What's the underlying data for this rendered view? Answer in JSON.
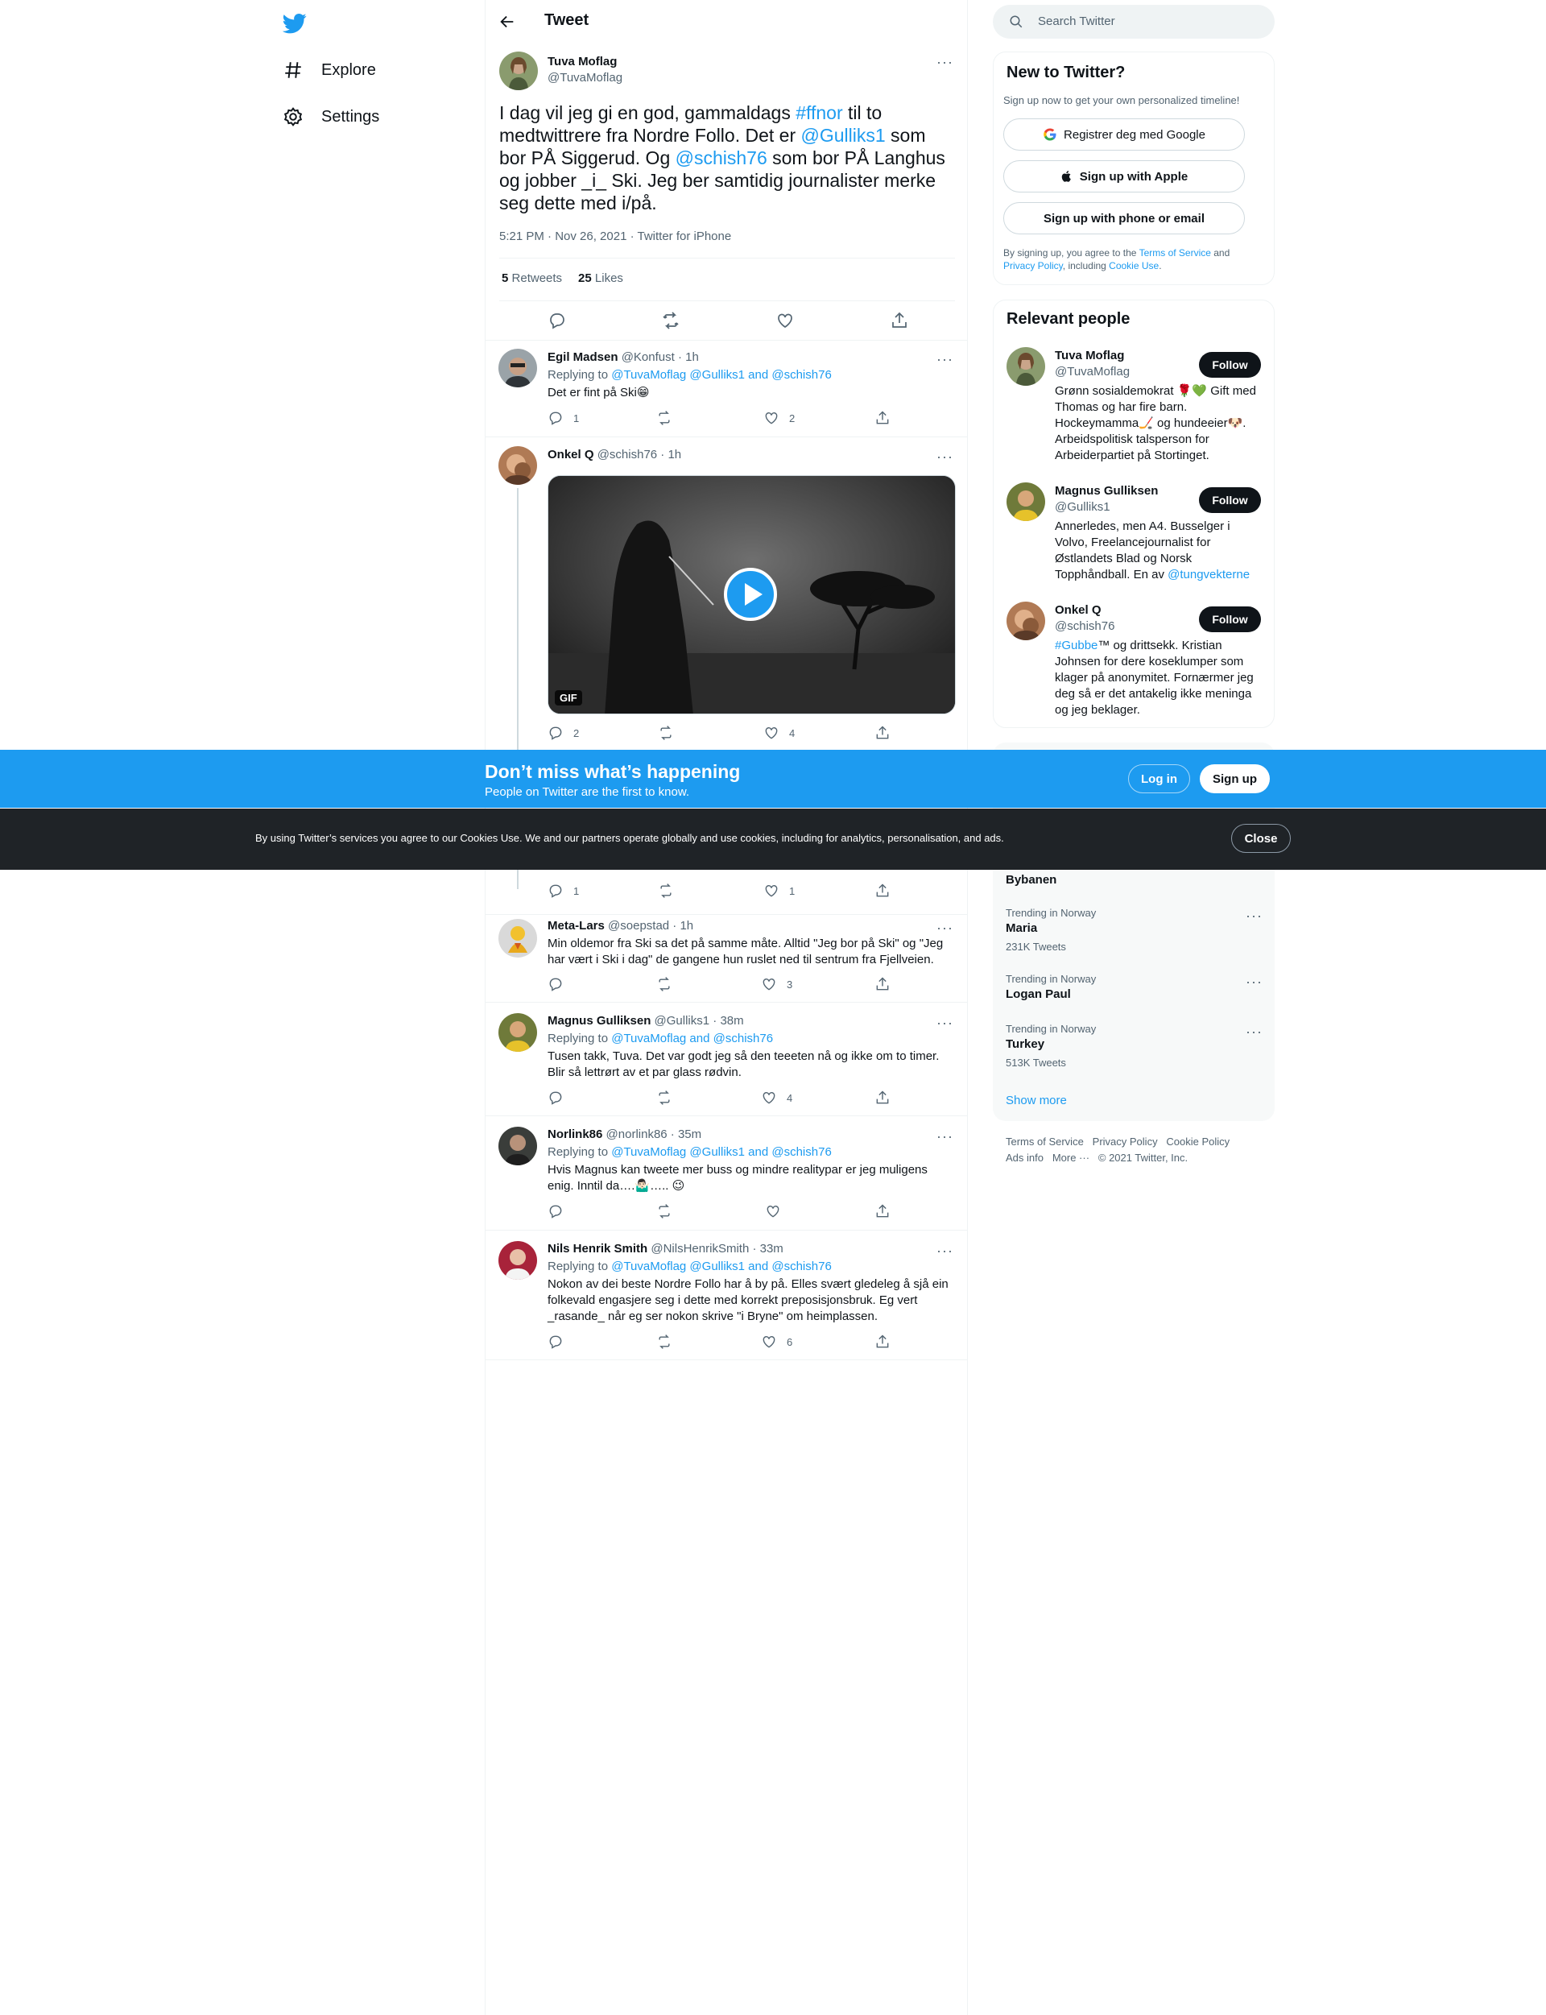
{
  "nav": {
    "items": [
      {
        "label": "Explore",
        "icon": "hashtag-icon"
      },
      {
        "label": "Settings",
        "icon": "gear-icon"
      }
    ]
  },
  "header": {
    "title": "Tweet"
  },
  "focal": {
    "name": "Tuva Moflag",
    "handle": "@TuvaMoflag",
    "text_parts": [
      {
        "t": "I dag vil jeg gi en god, gammaldags ",
        "link": false
      },
      {
        "t": "#ffnor",
        "link": true
      },
      {
        "t": " til to medtwittrere fra Nordre Follo. Det er ",
        "link": false
      },
      {
        "t": "@Gulliks1",
        "link": true
      },
      {
        "t": " som bor PÅ Siggerud. Og ",
        "link": false
      },
      {
        "t": "@schish76",
        "link": true
      },
      {
        "t": " som bor PÅ Langhus og jobber _i_ Ski. Jeg ber samtidig journalister merke seg dette med i/på.",
        "link": false
      }
    ],
    "meta": "5:21 PM · Nov 26, 2021 · Twitter for iPhone",
    "retweets": "5",
    "retweets_label": "Retweets",
    "likes": "25",
    "likes_label": "Likes"
  },
  "replies": [
    {
      "name": "Egil Madsen",
      "handle_time": "@Konfust · 1h",
      "replying_to": "@TuvaMoflag @Gulliks1 and @schish76",
      "text": "Det er fint på Ski😁",
      "replies": "1",
      "likes": "2"
    },
    {
      "name": "Onkel Q",
      "handle_time": "@schish76 · 1h",
      "gif_label": "GIF",
      "replies": "2",
      "likes": "4"
    },
    {
      "replies": "1",
      "likes": "1"
    },
    {
      "name": "Meta-Lars",
      "handle_time": "@soepstad · 1h",
      "text": "Min oldemor fra Ski sa det på samme måte. Alltid \"Jeg bor på Ski\" og \"Jeg har vært i Ski i dag\" de gangene hun ruslet ned til sentrum fra Fjellveien.",
      "replies": "",
      "likes": "3"
    },
    {
      "name": "Magnus Gulliksen",
      "handle_time": "@Gulliks1 · 38m",
      "replying_to": "@TuvaMoflag and @schish76",
      "text": "Tusen takk, Tuva. Det var godt jeg så den teeeten nå og ikke om to timer. Blir så lettrørt av et par glass rødvin.",
      "replies": "",
      "likes": "4"
    },
    {
      "name": "Norlink86",
      "handle_time": "@norlink86 · 35m",
      "replying_to": "@TuvaMoflag @Gulliks1 and @schish76",
      "text": "Hvis Magnus kan tweete mer buss og mindre realitypar er jeg muligens enig. Inntil da….🤷🏻‍♂️….. 😉",
      "replies": "",
      "likes": ""
    },
    {
      "name": "Nils Henrik Smith",
      "handle_time": "@NilsHenrikSmith · 33m",
      "replying_to": "@TuvaMoflag @Gulliks1 and @schish76",
      "text": "Nokon av dei beste Nordre Follo har å by på. Elles svært gledeleg å sjå ein folkevald engasjere seg i dette med korrekt preposisjonsbruk. Eg vert _rasande_ når eg ser nokon skrive \"i Bryne\" om heimplassen.",
      "replies": "",
      "likes": "6"
    }
  ],
  "sidebar": {
    "search_placeholder": "Search Twitter",
    "new_title": "New to Twitter?",
    "new_sub": "Sign up now to get your own personalized timeline!",
    "btn_google": "Registrer deg med Google",
    "btn_apple": "Sign up with Apple",
    "btn_phone": "Sign up with phone or email",
    "terms_1": "By signing up, you agree to the ",
    "terms_tos": "Terms of Service",
    "terms_2": " and ",
    "terms_pp": "Privacy Policy",
    "terms_3": ", including ",
    "terms_cookie": "Cookie Use",
    "terms_4": ".",
    "people_title": "Relevant people",
    "people": [
      {
        "name": "Tuva Moflag",
        "handle": "@TuvaMoflag",
        "bio": "Grønn sosialdemokrat 🌹💚 Gift med Thomas og har fire barn. Hockeymamma🏒 og hundeeier🐶. Arbeidspolitisk talsperson for Arbeiderpartiet på Stortinget.",
        "follow": "Follow"
      },
      {
        "name": "Magnus Gulliksen",
        "handle": "@Gulliks1",
        "bio": "Annerledes, men A4. Busselger i Volvo, Freelancejournalist for Østlandets Blad og Norsk Topphåndball. En av ",
        "bio_link": "@tungvekterne",
        "follow": "Follow"
      },
      {
        "name": "Onkel Q",
        "handle": "@schish76",
        "bio_link": "#Gubbe",
        "bio": "™ og drittsekk. Kristian Johnsen for dere koseklumper som klager på anonymitet. Fornærmer jeg deg så er det antakelig ikke meninga og jeg beklager.",
        "follow": "Follow"
      }
    ],
    "trends": [
      {
        "context": "",
        "name": "Bybanen",
        "count": ""
      },
      {
        "context": "Trending in Norway",
        "name": "Maria",
        "count": "231K Tweets"
      },
      {
        "context": "Trending in Norway",
        "name": "Logan Paul",
        "count": ""
      },
      {
        "context": "Trending in Norway",
        "name": "Turkey",
        "count": "513K Tweets"
      }
    ],
    "show_more": "Show more",
    "footer": {
      "tos": "Terms of Service",
      "privacy": "Privacy Policy",
      "cookie": "Cookie Policy",
      "ads": "Ads info",
      "more": "More ···",
      "copyright": "© 2021 Twitter, Inc."
    }
  },
  "banner": {
    "title": "Don’t miss what’s happening",
    "subtitle": "People on Twitter are the first to know.",
    "login": "Log in",
    "signup": "Sign up"
  },
  "cookie": {
    "text": "By using Twitter’s services you agree to our Cookies Use. We and our partners operate globally and use cookies, including for analytics, personalisation, and ads.",
    "close": "Close"
  },
  "colors": {
    "accent": "#1d9bf0",
    "text": "#0f1419",
    "muted": "#536471",
    "dark_banner": "#1f2327"
  }
}
